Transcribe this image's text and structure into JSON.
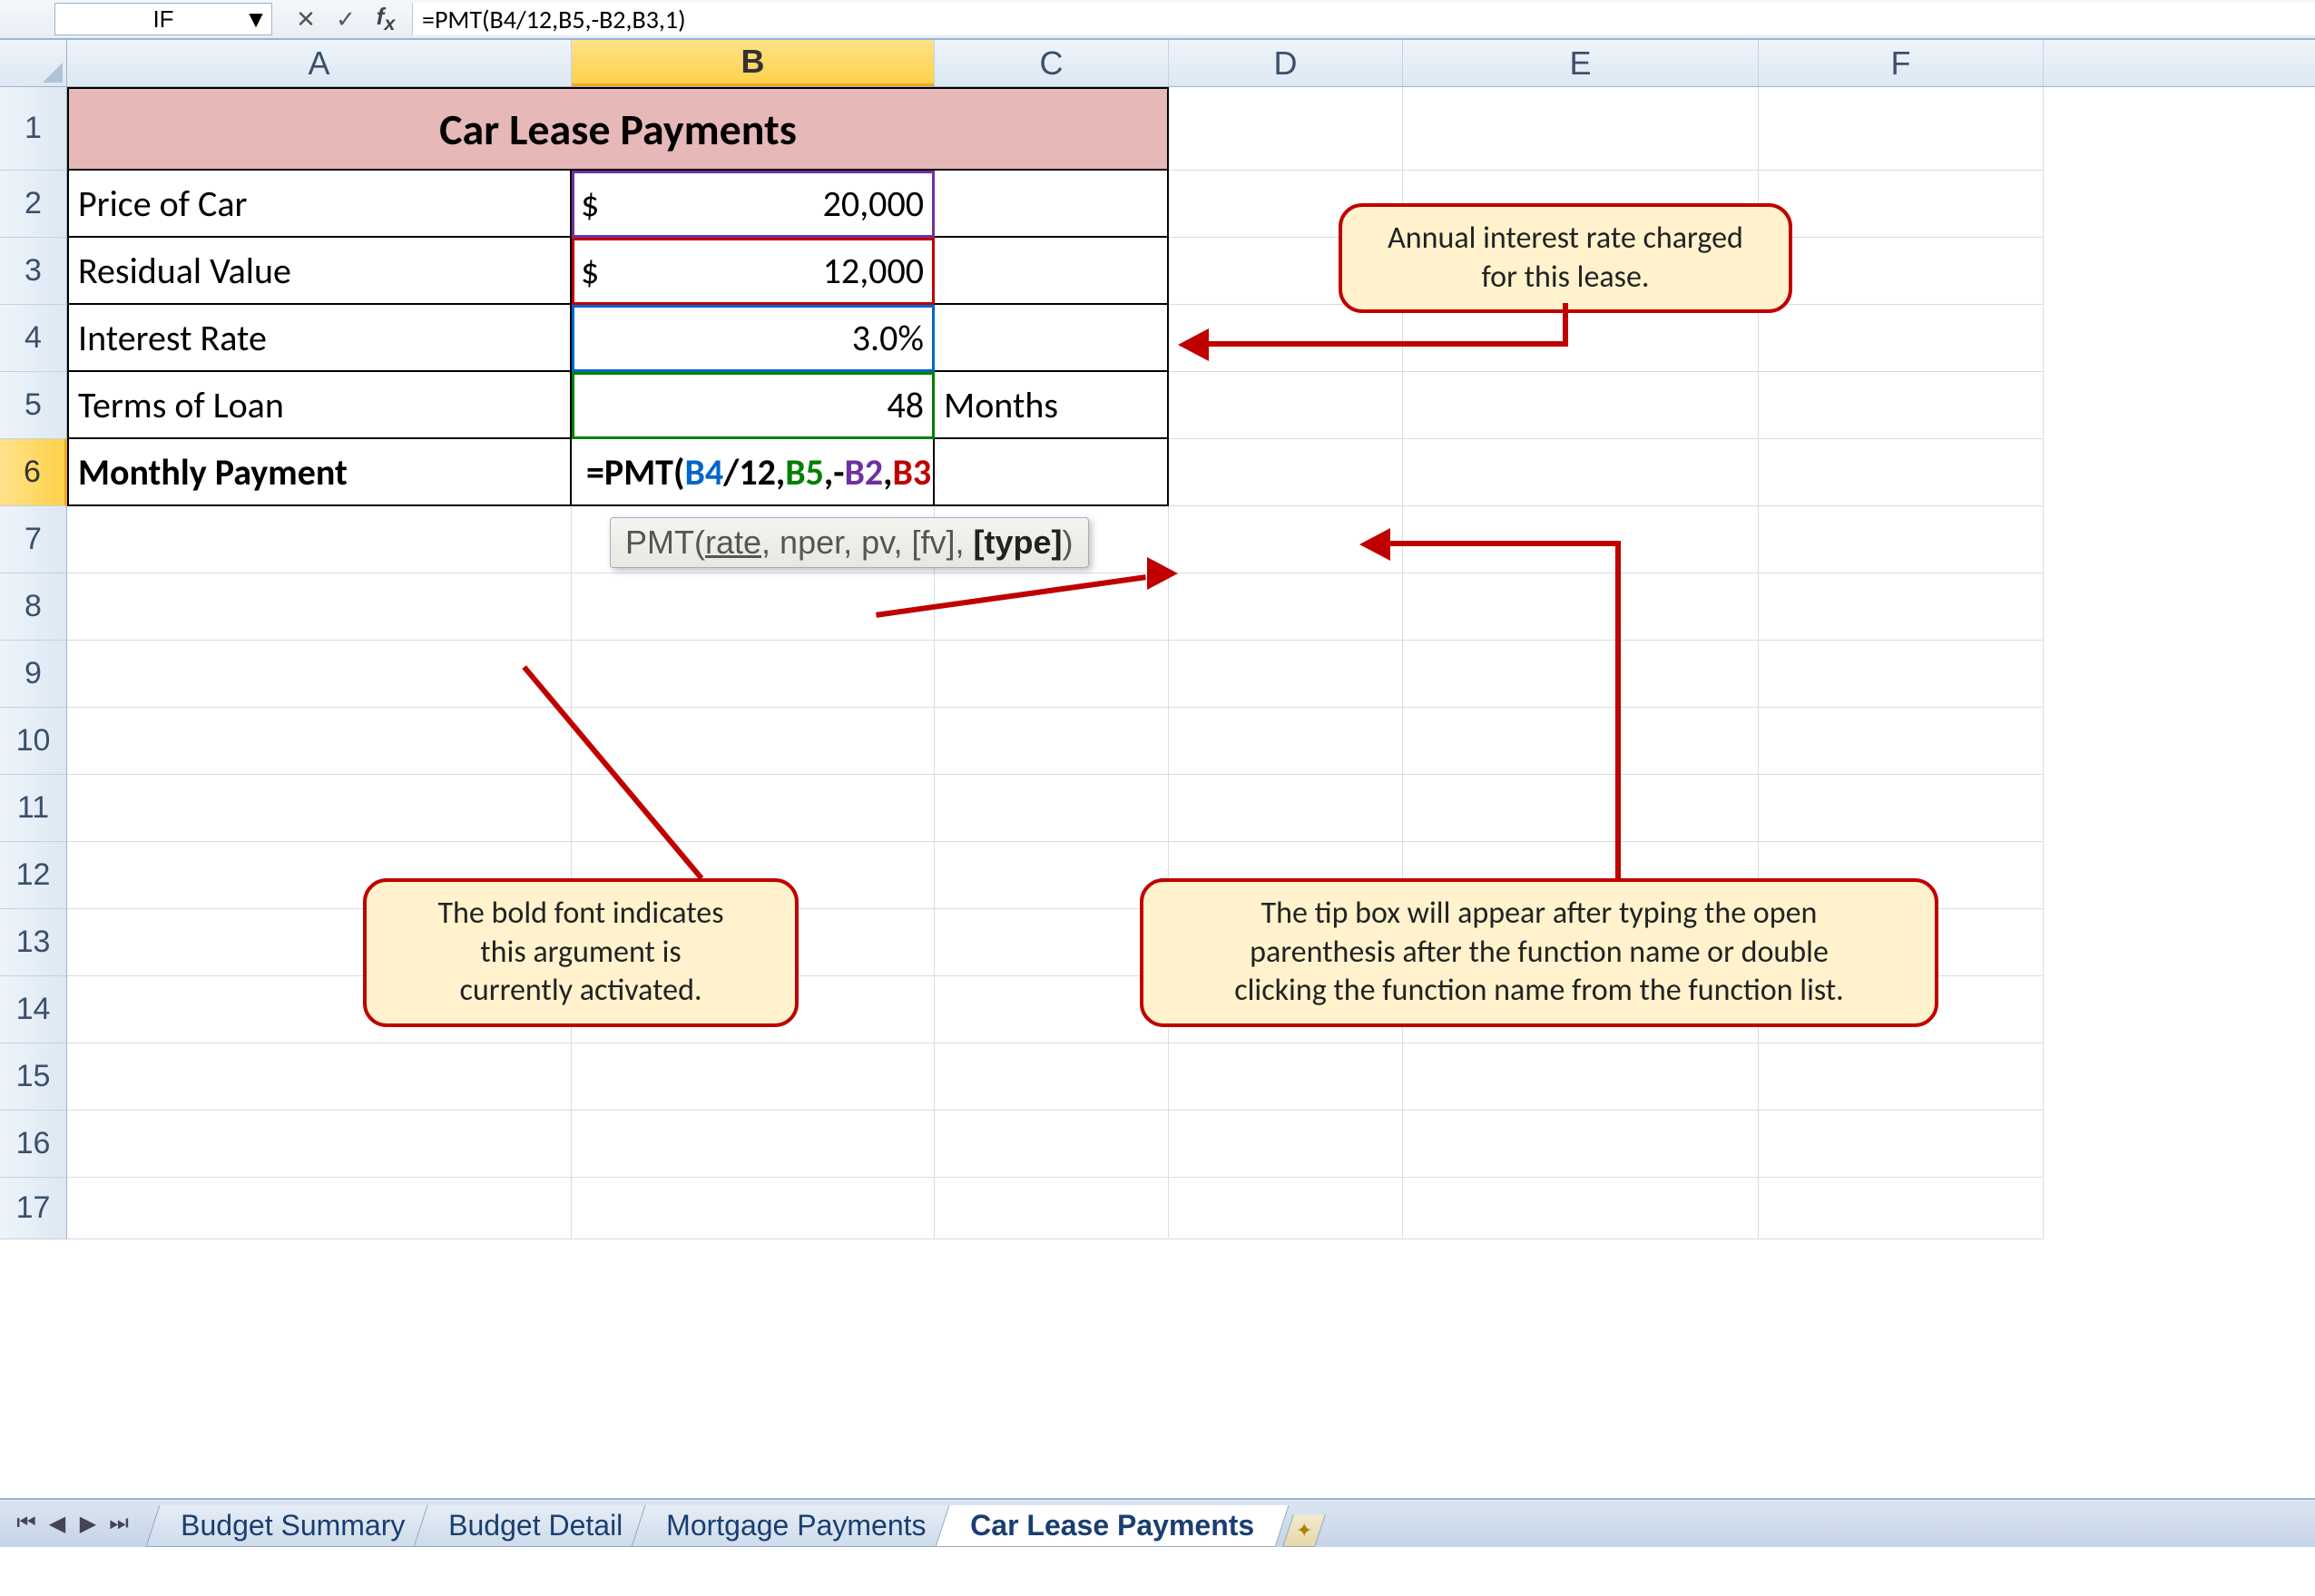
{
  "formula_bar": {
    "name_box": "IF",
    "formula": "=PMT(B4/12,B5,-B2,B3,1)"
  },
  "columns": [
    "A",
    "B",
    "C",
    "D",
    "E",
    "F"
  ],
  "rows": [
    "1",
    "2",
    "3",
    "4",
    "5",
    "6",
    "7",
    "8",
    "9",
    "10",
    "11",
    "12",
    "13",
    "14",
    "15",
    "16",
    "17"
  ],
  "sheet": {
    "title": "Car Lease Payments",
    "r2_label": "Price of Car",
    "r2_val_sym": "$",
    "r2_val": "20,000",
    "r3_label": "Residual Value",
    "r3_val_sym": "$",
    "r3_val": "12,000",
    "r4_label": "Interest Rate",
    "r4_val": "3.0%",
    "r5_label": "Terms of Loan",
    "r5_val": "48",
    "r5_unit": "Months",
    "r6_label": "Monthly Payment",
    "formula_prefix": "=PMT(",
    "formula_b4": "B4",
    "formula_d12": "/12,",
    "formula_b5": "B5",
    "formula_c1": ",-",
    "formula_b2": "B2",
    "formula_c2": ",",
    "formula_b3": "B3",
    "formula_suffix": ",1)"
  },
  "tooltip": {
    "fn": "PMT(",
    "a1": "rate",
    "s1": ", ",
    "a2": "nper",
    "s2": ", ",
    "a3": "pv",
    "s3": ", ",
    "a4": "[fv]",
    "s4": ", ",
    "a5": "[type]",
    "end": ")"
  },
  "callouts": {
    "c1": "Annual interest rate charged for this lease.",
    "c2_l1": "The bold font indicates",
    "c2_l2": "this argument is",
    "c2_l3": "currently activated.",
    "c3_l1": "The tip box will appear after typing the open",
    "c3_l2": "parenthesis after the function name or double",
    "c3_l3": "clicking the function name from the function list."
  },
  "tabs": {
    "t1": "Budget Summary",
    "t2": "Budget Detail",
    "t3": "Mortgage Payments",
    "t4": "Car Lease Payments"
  }
}
